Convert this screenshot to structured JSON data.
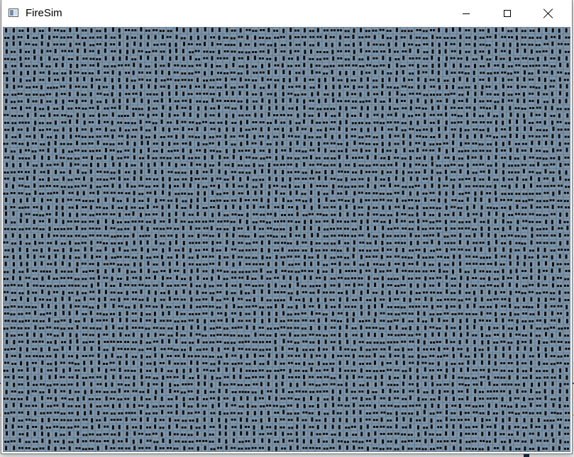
{
  "window": {
    "title": "FireSim",
    "icon": "app-window-icon",
    "controls": {
      "minimize": "minimize-icon",
      "maximize": "maximize-icon",
      "close": "close-icon"
    }
  },
  "grid": {
    "columns": 80,
    "rows": 60,
    "cell_color": "#8096aa",
    "line_color": "#4d6479",
    "mark_color": "#0a0a0a",
    "background_line_color": "#3c6aa6"
  }
}
